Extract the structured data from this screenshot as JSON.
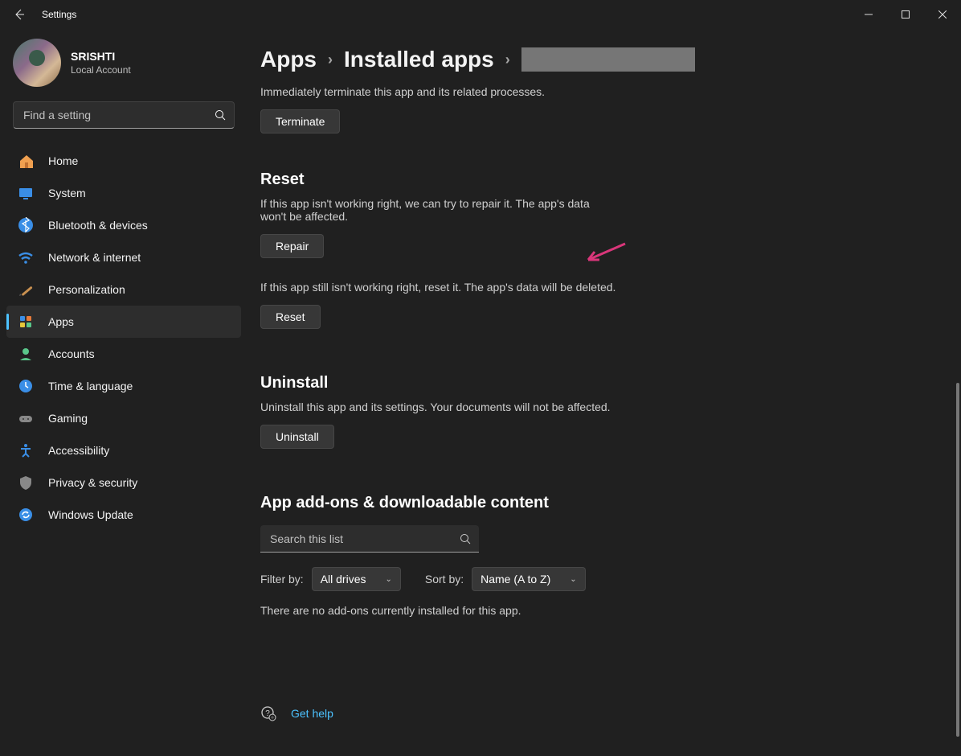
{
  "window": {
    "title": "Settings"
  },
  "profile": {
    "name": "SRISHTI",
    "subtitle": "Local Account"
  },
  "search": {
    "placeholder": "Find a setting"
  },
  "nav": {
    "items": [
      {
        "label": "Home",
        "icon": "home"
      },
      {
        "label": "System",
        "icon": "system"
      },
      {
        "label": "Bluetooth & devices",
        "icon": "bluetooth"
      },
      {
        "label": "Network & internet",
        "icon": "network"
      },
      {
        "label": "Personalization",
        "icon": "personalization"
      },
      {
        "label": "Apps",
        "icon": "apps",
        "active": true
      },
      {
        "label": "Accounts",
        "icon": "accounts"
      },
      {
        "label": "Time & language",
        "icon": "time"
      },
      {
        "label": "Gaming",
        "icon": "gaming"
      },
      {
        "label": "Accessibility",
        "icon": "accessibility"
      },
      {
        "label": "Privacy & security",
        "icon": "privacy"
      },
      {
        "label": "Windows Update",
        "icon": "update"
      }
    ]
  },
  "breadcrumb": {
    "level1": "Apps",
    "level2": "Installed apps"
  },
  "terminate": {
    "desc": "Immediately terminate this app and its related processes.",
    "button": "Terminate"
  },
  "reset": {
    "title": "Reset",
    "repair_desc": "If this app isn't working right, we can try to repair it. The app's data won't be affected.",
    "repair_button": "Repair",
    "reset_desc": "If this app still isn't working right, reset it. The app's data will be deleted.",
    "reset_button": "Reset"
  },
  "uninstall": {
    "title": "Uninstall",
    "desc": "Uninstall this app and its settings. Your documents will not be affected.",
    "button": "Uninstall"
  },
  "addons": {
    "title": "App add-ons & downloadable content",
    "search_placeholder": "Search this list",
    "filter_label": "Filter by:",
    "filter_value": "All drives",
    "sort_label": "Sort by:",
    "sort_value": "Name (A to Z)",
    "empty_msg": "There are no add-ons currently installed for this app."
  },
  "help": {
    "label": "Get help"
  }
}
